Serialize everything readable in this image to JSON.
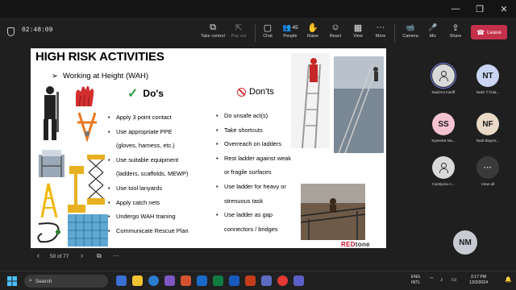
{
  "window": {
    "minimize": "—",
    "maximize": "❐",
    "close": "✕"
  },
  "meeting": {
    "timer": "02:48:09",
    "toolbar": [
      {
        "label": "Take control",
        "icon": "⧉"
      },
      {
        "label": "Pop out",
        "icon": "⇱"
      },
      {
        "label": "Chat",
        "icon": "▢"
      },
      {
        "label": "People",
        "icon": "👥",
        "count": "45"
      },
      {
        "label": "Raise",
        "icon": "✋"
      },
      {
        "label": "React",
        "icon": "☺"
      },
      {
        "label": "View",
        "icon": "▦"
      },
      {
        "label": "More",
        "icon": "···"
      },
      {
        "label": "Camera",
        "icon": "📹"
      },
      {
        "label": "Mic",
        "icon": "🎤"
      },
      {
        "label": "Share",
        "icon": "⇪"
      }
    ],
    "leave_label": "Leave",
    "leave_color": "#c4314b"
  },
  "slide": {
    "title": "HIGH RISK ACTIVITIES",
    "subtitle": "Working at Height (WAH)",
    "subtitle_arrow": "➢",
    "dos_title": "Do's",
    "donts_title": "Don'ts",
    "dos": [
      "Apply 3 point contact",
      "Use appropriate PPE",
      "(gloves, harness, etc.)",
      "Use suitable equipment",
      "(ladders, scaffolds, MEWP)",
      "Use tool lanyards",
      "Apply catch nets",
      "Undergo WAH training",
      "Communicate Rescue Plan"
    ],
    "donts": [
      "Do unsafe act(s)",
      "Take shortcuts",
      "Overreach on ladders",
      "Rest ladder against weak",
      "or fragile surfaces",
      "Use ladder for heavy or",
      "strenuous task",
      "Use ladder as gap",
      "connectors / bridges"
    ],
    "brand_red": "RED",
    "brand_rest": "tone"
  },
  "presentation": {
    "prev_icon": "‹",
    "next_icon": "›",
    "page_info": "50 of 77",
    "grid_icon": "⧉",
    "more_icon": "···"
  },
  "participants": [
    {
      "initials": "",
      "name": "Nadzmi Hariff",
      "color": "#d9d9d9",
      "photo": true,
      "speaking": true
    },
    {
      "initials": "NT",
      "name": "NaDi T.Tula...",
      "color": "#c9d5f3",
      "photo": false,
      "speaking": false
    },
    {
      "initials": "SS",
      "name": "Sywesta Na...",
      "color": "#f4c3d1",
      "photo": false,
      "speaking": false
    },
    {
      "initials": "NF",
      "name": "Nadi Bayon...",
      "color": "#ead9c8",
      "photo": false,
      "speaking": false
    },
    {
      "initials": "",
      "name": "Cantiynia A...",
      "color": "#d9d9d9",
      "photo": true,
      "speaking": false
    },
    {
      "initials": "···",
      "name": "View all",
      "color": "#3a3a3a",
      "photo": false,
      "speaking": false
    }
  ],
  "self_view": {
    "initials": "NM",
    "color": "#c7cbd1"
  },
  "taskbar": {
    "search_placeholder": "Search",
    "language": "ENG",
    "region": "INTL",
    "time": "3:17 PM",
    "date": "13/3/2024"
  }
}
